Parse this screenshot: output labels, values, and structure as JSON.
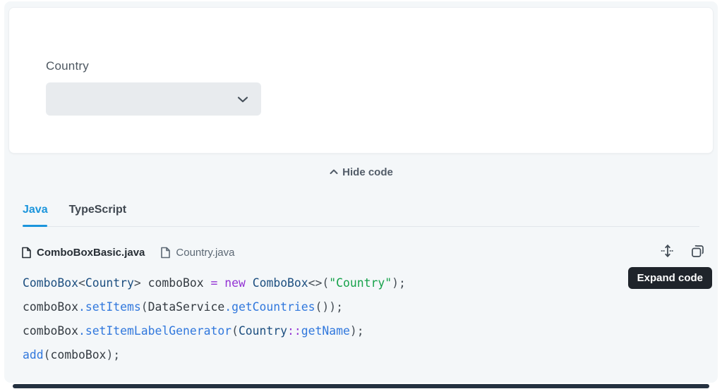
{
  "demo": {
    "field_label": "Country",
    "combobox_value": ""
  },
  "toolbar": {
    "hide_code_label": "Hide code"
  },
  "tabs": [
    {
      "label": "Java",
      "active": true
    },
    {
      "label": "TypeScript",
      "active": false
    }
  ],
  "files": [
    {
      "name": "ComboBoxBasic.java",
      "active": true
    },
    {
      "name": "Country.java",
      "active": false
    }
  ],
  "actions": {
    "expand_icon": "expand-code-vertical-icon",
    "copy_icon": "copy-code-icon",
    "tooltip_text": "Expand code"
  },
  "colors": {
    "page_background": "#ffffff",
    "panel_background": "#f4f7f9",
    "card_background": "#ffffff",
    "combobox_background": "#e8ebee",
    "active_tab_blue": "#1b95dc",
    "tooltip_background": "#1f242b",
    "code_type": "#1d4f80",
    "code_plain": "#343b42",
    "code_keyword": "#9333d4",
    "code_method": "#3178dd",
    "code_string": "#17a24b",
    "scrollbar": "#243140"
  },
  "code": {
    "language": "java",
    "lines": [
      [
        [
          "t",
          "ComboBox"
        ],
        [
          "o",
          "<"
        ],
        [
          "t",
          "Country"
        ],
        [
          "o",
          "> "
        ],
        [
          "p",
          "comboBox"
        ],
        [
          "o",
          " "
        ],
        [
          "k",
          "="
        ],
        [
          "o",
          " "
        ],
        [
          "k",
          "new"
        ],
        [
          "o",
          " "
        ],
        [
          "t",
          "ComboBox"
        ],
        [
          "o",
          "<>("
        ],
        [
          "s",
          "\"Country\""
        ],
        [
          "o",
          ");"
        ]
      ],
      [
        [
          "p",
          "comboBox"
        ],
        [
          "m",
          ".setItems"
        ],
        [
          "o",
          "("
        ],
        [
          "p",
          "DataService"
        ],
        [
          "m",
          ".getCountries"
        ],
        [
          "o",
          "());"
        ]
      ],
      [
        [
          "p",
          "comboBox"
        ],
        [
          "m",
          ".setItemLabelGenerator"
        ],
        [
          "o",
          "("
        ],
        [
          "t",
          "Country"
        ],
        [
          "k",
          "::"
        ],
        [
          "m",
          "getName"
        ],
        [
          "o",
          ");"
        ]
      ],
      [
        [
          "m",
          "add"
        ],
        [
          "o",
          "("
        ],
        [
          "p",
          "comboBox"
        ],
        [
          "o",
          ");"
        ]
      ]
    ]
  }
}
